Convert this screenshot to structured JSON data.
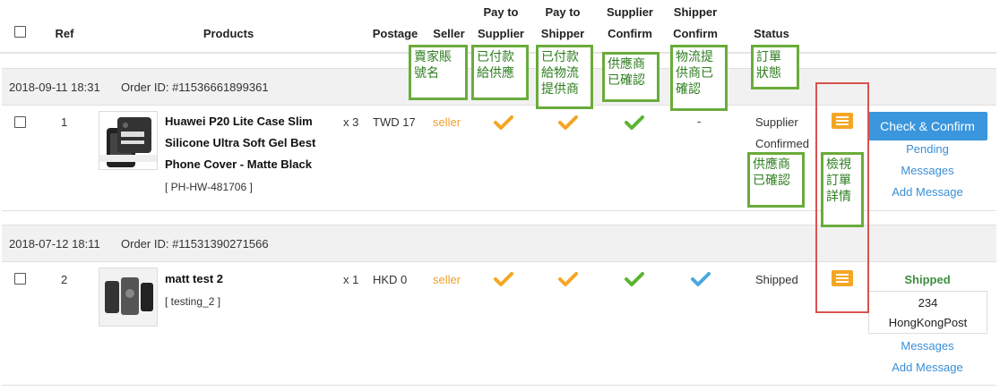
{
  "headers": {
    "ref": "Ref",
    "products": "Products",
    "postage": "Postage",
    "seller": "Seller",
    "pay_supplier_l1": "Pay to",
    "pay_supplier_l2": "Supplier",
    "pay_shipper_l1": "Pay to",
    "pay_shipper_l2": "Shipper",
    "supplier_confirm_l1": "Supplier",
    "supplier_confirm_l2": "Confirm",
    "shipper_confirm_l1": "Shipper",
    "shipper_confirm_l2": "Confirm",
    "status": "Status"
  },
  "annotations": {
    "seller_l1": "賣家賬",
    "seller_l2": "號名",
    "pay_supplier_l1": "已付款",
    "pay_supplier_l2": "給供應",
    "pay_shipper_l1": "已付款",
    "pay_shipper_l2": "給物流",
    "pay_shipper_l3": "提供商",
    "supplier_confirm_l1": "供應商",
    "supplier_confirm_l2": "已確認",
    "shipper_confirm_l1": "物流提",
    "shipper_confirm_l2": "供商已",
    "shipper_confirm_l3": "確認",
    "status_l1": "訂單",
    "status_l2": "狀態",
    "status_value_l1": "供應商",
    "status_value_l2": "已確認",
    "view_l1": "檢視",
    "view_l2": "訂單",
    "view_l3": "詳情"
  },
  "orders": [
    {
      "date": "2018-09-11 18:31",
      "order_id": "Order ID: #11536661899361",
      "ref": "1",
      "product_name_l1": "Huawei P20 Lite Case Slim",
      "product_name_l2": "Silicone Ultra Soft Gel Best",
      "product_name_l3": "Phone Cover - Matte Black",
      "sku": "[ PH-HW-481706 ]",
      "qty": "x 3",
      "postage": "TWD 17",
      "seller": "seller",
      "shipper_confirm": "-",
      "status_l1": "Supplier",
      "status_l2": "Confirmed",
      "action_button": "Check & Confirm",
      "links": [
        "Pending",
        "Messages",
        "Add Message"
      ]
    },
    {
      "date": "2018-07-12 18:11",
      "order_id": "Order ID: #11531390271566",
      "ref": "2",
      "product_name_l1": "matt test 2",
      "sku": "[ testing_2 ]",
      "qty": "x 1",
      "postage": "HKD 0",
      "seller": "seller",
      "status_l1": "Shipped",
      "shipped_label": "Shipped",
      "tracking_number": "234",
      "carrier": "HongKongPost",
      "links": [
        "Messages",
        "Add Message"
      ]
    }
  ],
  "colors": {
    "orange_check": "#f5a623",
    "green_check": "#5cb531",
    "blue_check": "#4aa8e0",
    "annotation_border": "#6aab3a",
    "highlight_box": "#d9534f",
    "primary_button": "#3a96dd"
  },
  "icons": [
    "checkbox-icon",
    "checkmark-icon",
    "order-details-icon"
  ]
}
